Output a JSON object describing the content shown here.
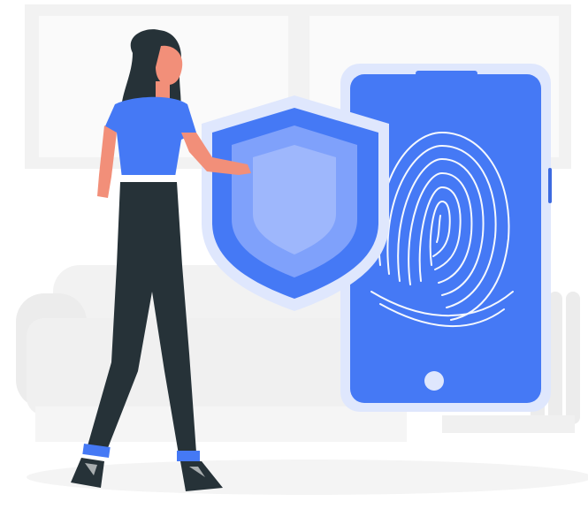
{
  "illustration": {
    "subject": "",
    "colors": {
      "accent": "#4579f5",
      "accent_dark": "#3d6ae0",
      "accent_light": "#7fa1fb",
      "accent_pale": "#b8cbfd",
      "phone_frame": "#dfe7fd",
      "background_shape": "#f2f2f2",
      "background_shape_dark": "#e6e6e6",
      "clothing_dark": "#263238",
      "skin": "#f28f79",
      "fingerprint_line": "#ffffff"
    },
    "icons": {
      "shield": "shield-icon",
      "fingerprint": "fingerprint-icon",
      "phone": "smartphone-icon",
      "home_button": "home-button-icon"
    }
  }
}
